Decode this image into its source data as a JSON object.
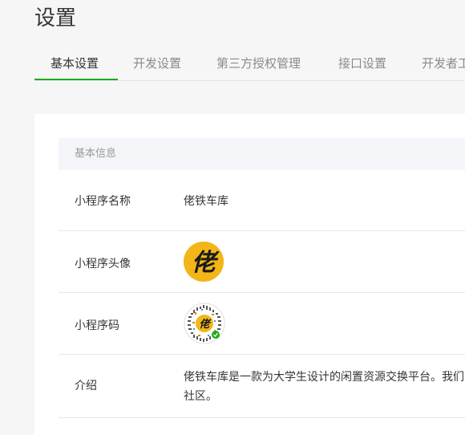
{
  "page": {
    "title": "设置"
  },
  "tabs": [
    {
      "label": "基本设置",
      "active": true
    },
    {
      "label": "开发设置",
      "active": false
    },
    {
      "label": "第三方授权管理",
      "active": false
    },
    {
      "label": "接口设置",
      "active": false
    },
    {
      "label": "开发者工",
      "active": false
    }
  ],
  "basic_info": {
    "section_title": "基本信息",
    "name_label": "小程序名称",
    "name_value": "佬铁车库",
    "avatar_label": "小程序头像",
    "avatar_glyph": "佬",
    "code_label": "小程序码",
    "intro_label": "介绍",
    "intro_line1": "佬铁车库是一款为大学生设计的闲置资源交换平台。我们的",
    "intro_line2": "社区。"
  },
  "colors": {
    "accent": "#1aad19",
    "avatar_bg": "#f2b619"
  }
}
